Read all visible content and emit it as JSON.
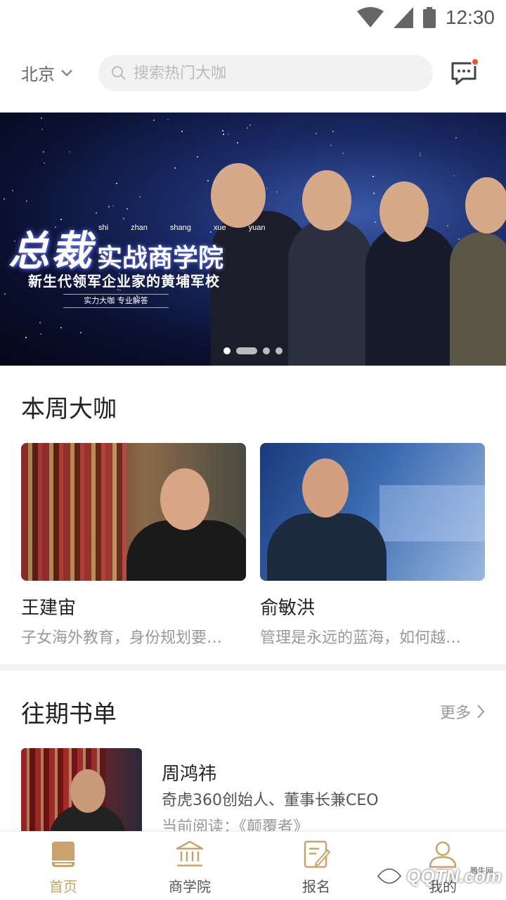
{
  "status_bar": {
    "time": "12:30"
  },
  "header": {
    "city": "北京",
    "search_placeholder": "搜索热门大咖"
  },
  "banner": {
    "title_big": "总裁",
    "title_small": "实战商学院",
    "pinyin": [
      "shi",
      "zhan",
      "shang",
      "xue",
      "yuan"
    ],
    "subtitle": "新生代领军企业家的黄埔军校",
    "tag": "实力大咖  专业解答",
    "page_count": 4,
    "active_page": 1
  },
  "weekly": {
    "title": "本周大咖",
    "cards": [
      {
        "name": "王建宙",
        "desc": "子女海外教育，身份规划要…"
      },
      {
        "name": "俞敏洪",
        "desc": "管理是永远的蓝海，如何越…"
      }
    ]
  },
  "past": {
    "title": "往期书单",
    "more": "更多",
    "items": [
      {
        "name": "周鸿祎",
        "title": "奇虎360创始人、董事长兼CEO",
        "reading": "当前阅读：《颠覆者》"
      }
    ]
  },
  "nav": {
    "items": [
      {
        "label": "首页",
        "icon": "book-icon",
        "active": true
      },
      {
        "label": "商学院",
        "icon": "bank-icon",
        "active": false
      },
      {
        "label": "报名",
        "icon": "form-icon",
        "active": false
      },
      {
        "label": "我的",
        "icon": "user-icon",
        "active": false
      }
    ]
  },
  "colors": {
    "accent": "#c9a36b",
    "badge": "#f0542d"
  },
  "watermark": {
    "text": "QQTN.com",
    "small": "腾牛网"
  }
}
